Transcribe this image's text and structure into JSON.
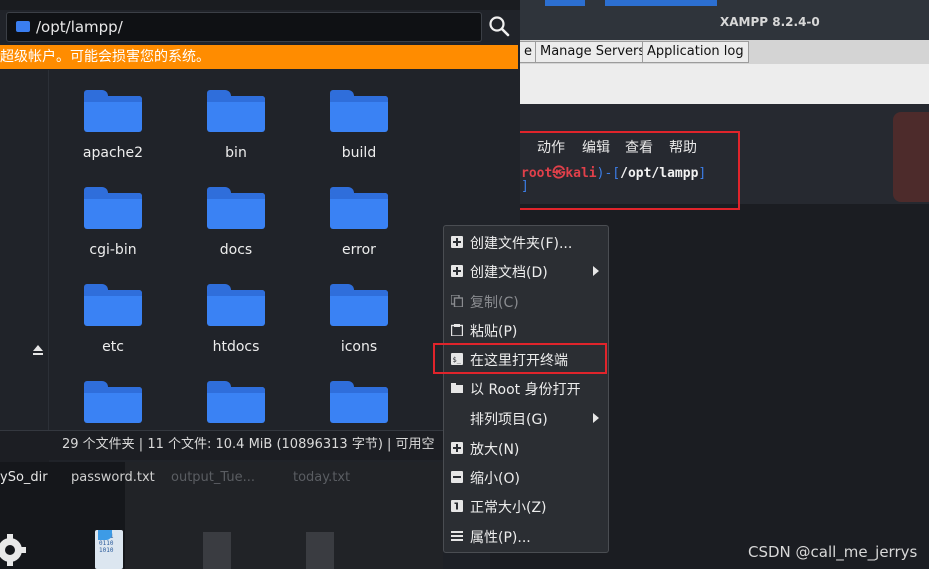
{
  "xampp": {
    "title": "XAMPP 8.2.4-0",
    "tabs": [
      "e",
      "Manage Servers",
      "Application log"
    ]
  },
  "terminal": {
    "menu": [
      "动作",
      "编辑",
      "查看",
      "帮助"
    ],
    "prompt_user": "root",
    "prompt_at": "㉿",
    "prompt_host": "kali",
    "prompt_sep": ")-[",
    "prompt_path": "/opt/lampp",
    "prompt_end": "]",
    "cursor": "]"
  },
  "file_manager": {
    "path": "/opt/lampp/",
    "warning": "超级帐户。可能会损害您的系统。",
    "folders": [
      "apache2",
      "bin",
      "build",
      "cgi-bin",
      "docs",
      "error",
      "etc",
      "htdocs",
      "icons",
      "",
      "",
      ""
    ],
    "status": "29 个文件夹 | 11 个文件: 10.4 MiB (10896313 字节) | 可用空"
  },
  "desktop": {
    "labels": [
      "ySo_dir",
      "password.txt",
      "output_Tue...",
      "today.txt"
    ]
  },
  "context_menu": {
    "items": [
      {
        "label": "创建文件夹(F)...",
        "icon": "folder-plus-icon",
        "disabled": false,
        "submenu": false
      },
      {
        "label": "创建文档(D)",
        "icon": "document-plus-icon",
        "disabled": false,
        "submenu": true
      },
      {
        "label": "复制(C)",
        "icon": "copy-icon",
        "disabled": true,
        "submenu": false
      },
      {
        "label": "粘贴(P)",
        "icon": "paste-icon",
        "disabled": false,
        "submenu": false
      },
      {
        "label": "在这里打开终端",
        "icon": "terminal-icon",
        "disabled": false,
        "submenu": false
      },
      {
        "label": "以 Root 身份打开",
        "icon": "folder-icon",
        "disabled": false,
        "submenu": false
      },
      {
        "label": "排列项目(G)",
        "icon": "",
        "disabled": false,
        "submenu": true
      },
      {
        "label": "放大(N)",
        "icon": "zoom-in-icon",
        "disabled": false,
        "submenu": false
      },
      {
        "label": "缩小(O)",
        "icon": "zoom-out-icon",
        "disabled": false,
        "submenu": false
      },
      {
        "label": "正常大小(Z)",
        "icon": "zoom-normal-icon",
        "disabled": false,
        "submenu": false
      },
      {
        "label": "属性(P)...",
        "icon": "properties-icon",
        "disabled": false,
        "submenu": false
      }
    ]
  },
  "watermark": "CSDN @call_me_jerrys",
  "colors": {
    "accent": "#3a82f4",
    "warning": "#ff8c00",
    "highlight": "#e0242b"
  }
}
